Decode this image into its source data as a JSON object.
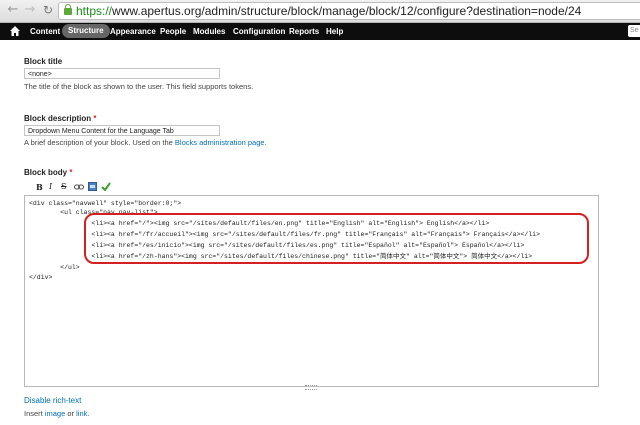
{
  "browser": {
    "url_scheme": "https://",
    "url_rest": "www.apertus.org/admin/structure/block/manage/block/12/configure?destination=node/24"
  },
  "toolbar": {
    "items": [
      "Content",
      "Structure",
      "Appearance",
      "People",
      "Modules",
      "Configuration",
      "Reports",
      "Help"
    ],
    "search": "Se"
  },
  "form": {
    "block_title": {
      "label": "Block title",
      "value": "<none>",
      "description": "The title of the block as shown to the user. This field supports tokens."
    },
    "block_description": {
      "label": "Block description",
      "required_mark": "*",
      "value": "Dropdown Menu Content for the Language Tab",
      "description_before": "A brief description of your block. Used on the ",
      "description_link": "Blocks administration page",
      "description_after": "."
    },
    "block_body": {
      "label": "Block body",
      "required_mark": "*",
      "editor_buttons": [
        "B",
        "I",
        "S"
      ],
      "code_lines": [
        "<div class=\"navwell\" style=\"border:0;\">",
        "        <ul class=\"nav nav-list\">",
        "                <li><a href=\"/\"><img src=\"/sites/default/files/en.png\" title=\"English\" alt=\"English\"> English</a></li>",
        "                <li><a href=\"/fr/accueil\"><img src=\"/sites/default/files/fr.png\" title=\"Français\" alt=\"Français\"> Français</a></li>",
        "                <li><a href=\"/es/inicio\"><img src=\"/sites/default/files/es.png\" title=\"Español\" alt=\"Español\"> Español</a></li>",
        "                <li><a href=\"/zh-hans\"><img src=\"/sites/default/files/chinese.png\" title=\"简体中文\" alt=\"简体中文\"> 简体中文</a></li>",
        "        </ul>",
        "</div>"
      ]
    },
    "disable_rich_text": "Disable rich-text",
    "insert_prefix": "Insert ",
    "insert_image": "image",
    "insert_or": " or ",
    "insert_link": "link",
    "insert_suffix": "."
  },
  "colors": {
    "link": "#0070b8",
    "required": "#cc2b2b",
    "highlight": "#d62020",
    "toolbar_bg": "#0d0d0d"
  }
}
